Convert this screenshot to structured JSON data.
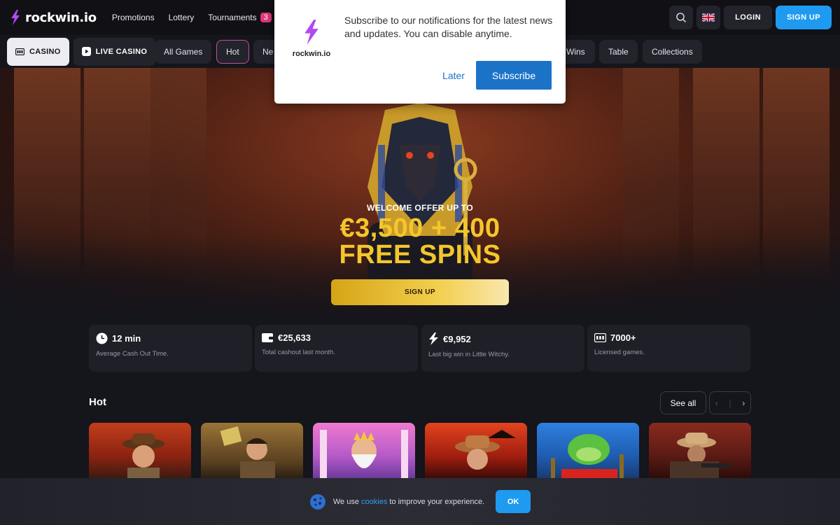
{
  "brand": {
    "name": "rockwin.io",
    "accent": "#1e9bf0",
    "bolt_color": "#b04bf0"
  },
  "header": {
    "nav": [
      {
        "label": "Promotions"
      },
      {
        "label": "Lottery"
      },
      {
        "label": "Tournaments",
        "badge": "3"
      }
    ],
    "icons": [
      "search-icon",
      "uk-flag-icon"
    ],
    "login_label": "LOGIN",
    "signup_label": "SIGN UP"
  },
  "categories": {
    "casino_label": "CASINO",
    "live_label": "LIVE CASINO",
    "tabs": [
      "All Games",
      "Hot",
      "Ne",
      "Wins",
      "Table",
      "Collections"
    ],
    "active_tab": "Hot"
  },
  "hero": {
    "welcome": "WELCOME OFFER UP TO",
    "amount": "€3,500 + 400",
    "spins": "FREE SPINS",
    "cta": "SIGN UP"
  },
  "stats": [
    {
      "icon": "clock-icon",
      "value": "12 min",
      "label": "Average Cash Out Time."
    },
    {
      "icon": "wallet-icon",
      "value": "€25,633",
      "label": "Total cashout last month."
    },
    {
      "icon": "bolt-icon",
      "value": "€9,952",
      "label": "Last big win in Little Witchy."
    },
    {
      "icon": "slot-icon",
      "value": "7000+",
      "label": "Licensed games."
    }
  ],
  "section": {
    "title": "Hot",
    "see_all": "See all",
    "prev": "‹",
    "next": "›"
  },
  "cookie": {
    "before": "We use ",
    "link": "cookies",
    "after": " to improve your experience.",
    "ok": "OK"
  },
  "popup": {
    "logo_text": "rockwin.io",
    "message": "Subscribe to our notifications for the latest news and updates. You can disable anytime.",
    "later": "Later",
    "subscribe": "Subscribe"
  }
}
